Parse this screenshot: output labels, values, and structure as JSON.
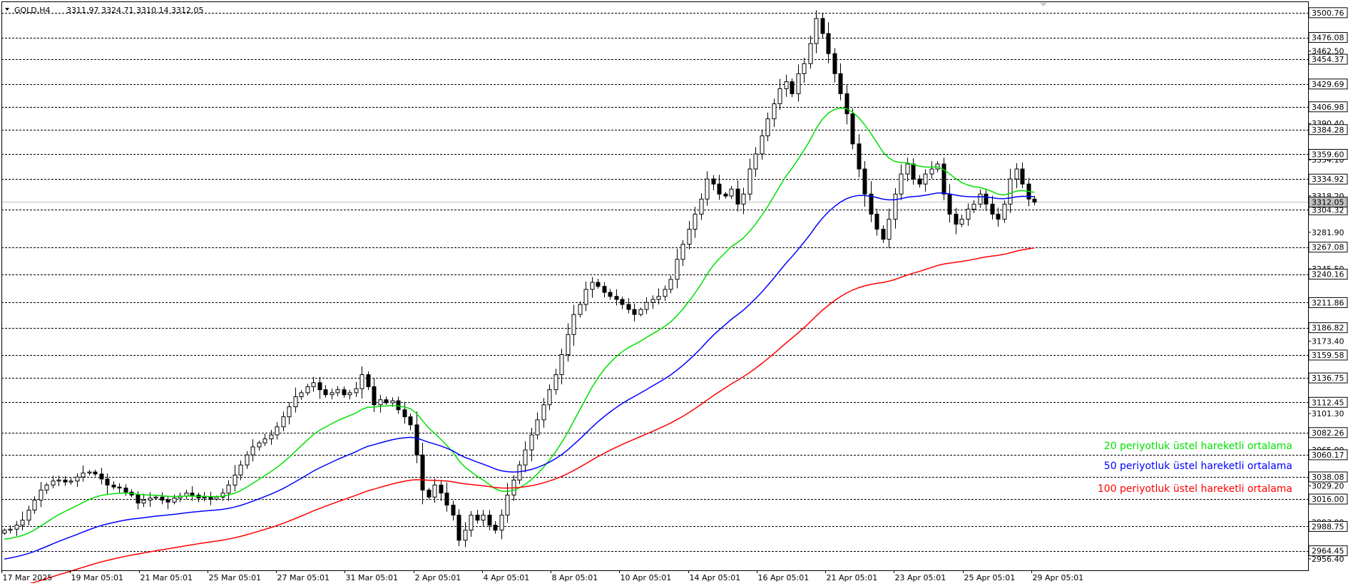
{
  "header": {
    "symbol": "GOLD,H4",
    "ohlc": "3311.97 3324.71 3310.14 3312.05"
  },
  "legend": [
    {
      "label": "20 periyotluk üstel hareketli ortalama",
      "color": "#00e000"
    },
    {
      "label": "50 periyotluk üstel hareketli ortalama",
      "color": "#0000ff"
    },
    {
      "label": "100 periyotluk üstel hareketli ortalama",
      "color": "#ff0000"
    }
  ],
  "chart_data": {
    "type": "candlestick",
    "ylim": [
      2945,
      3512
    ],
    "grid": false,
    "current_price": 3312.05,
    "y_ticks": [
      3462.5,
      3390.4,
      3354.1,
      3318.2,
      3281.9,
      3245.5,
      3173.4,
      3101.3,
      3065.0,
      3029.2,
      2993.0,
      2956.4
    ],
    "levels": [
      3500.76,
      3476.08,
      3454.37,
      3429.69,
      3406.98,
      3384.28,
      3359.6,
      3334.92,
      3304.32,
      3267.08,
      3240.16,
      3211.86,
      3186.82,
      3159.58,
      3136.75,
      3112.45,
      3082.26,
      3060.17,
      3038.08,
      3016.0,
      2988.75,
      2964.45
    ],
    "x_labels": [
      "17 Mar 2025",
      "19 Mar 05:01",
      "21 Mar 05:01",
      "25 Mar 05:01",
      "27 Mar 05:01",
      "31 Mar 05:01",
      "2 Apr 05:01",
      "4 Apr 05:01",
      "8 Apr 05:01",
      "10 Apr 05:01",
      "14 Apr 05:01",
      "16 Apr 05:01",
      "21 Apr 05:01",
      "23 Apr 05:01",
      "25 Apr 05:01",
      "29 Apr 05:01"
    ],
    "close_path": [
      2985,
      2986,
      2990,
      2995,
      3005,
      3015,
      3025,
      3030,
      3034,
      3035,
      3033,
      3034,
      3038,
      3042,
      3043,
      3041,
      3036,
      3030,
      3028,
      3027,
      3023,
      3020,
      3012,
      3015,
      3017,
      3018,
      3015,
      3013,
      3017,
      3019,
      3022,
      3020,
      3017,
      3018,
      3016,
      3018,
      3022,
      3030,
      3040,
      3050,
      3060,
      3068,
      3072,
      3076,
      3080,
      3088,
      3098,
      3108,
      3118,
      3122,
      3128,
      3132,
      3125,
      3120,
      3122,
      3125,
      3120,
      3122,
      3126,
      3140,
      3128,
      3110,
      3115,
      3112,
      3114,
      3105,
      3098,
      3090,
      3060,
      3025,
      3018,
      3030,
      3022,
      3010,
      3000,
      2975,
      2985,
      3000,
      2995,
      3000,
      2990,
      2985,
      3000,
      3020,
      3035,
      3050,
      3065,
      3080,
      3095,
      3110,
      3125,
      3140,
      3160,
      3180,
      3200,
      3210,
      3225,
      3232,
      3228,
      3222,
      3218,
      3215,
      3210,
      3205,
      3200,
      3205,
      3212,
      3215,
      3218,
      3225,
      3235,
      3255,
      3270,
      3285,
      3300,
      3315,
      3335,
      3330,
      3320,
      3318,
      3325,
      3310,
      3320,
      3345,
      3360,
      3378,
      3395,
      3410,
      3425,
      3432,
      3420,
      3440,
      3450,
      3470,
      3495,
      3480,
      3460,
      3440,
      3420,
      3400,
      3370,
      3345,
      3320,
      3300,
      3285,
      3275,
      3295,
      3320,
      3340,
      3350,
      3335,
      3330,
      3340,
      3345,
      3350,
      3320,
      3300,
      3290,
      3295,
      3305,
      3310,
      3320,
      3310,
      3300,
      3295,
      3310,
      3335,
      3345,
      3330,
      3315,
      3312
    ]
  }
}
